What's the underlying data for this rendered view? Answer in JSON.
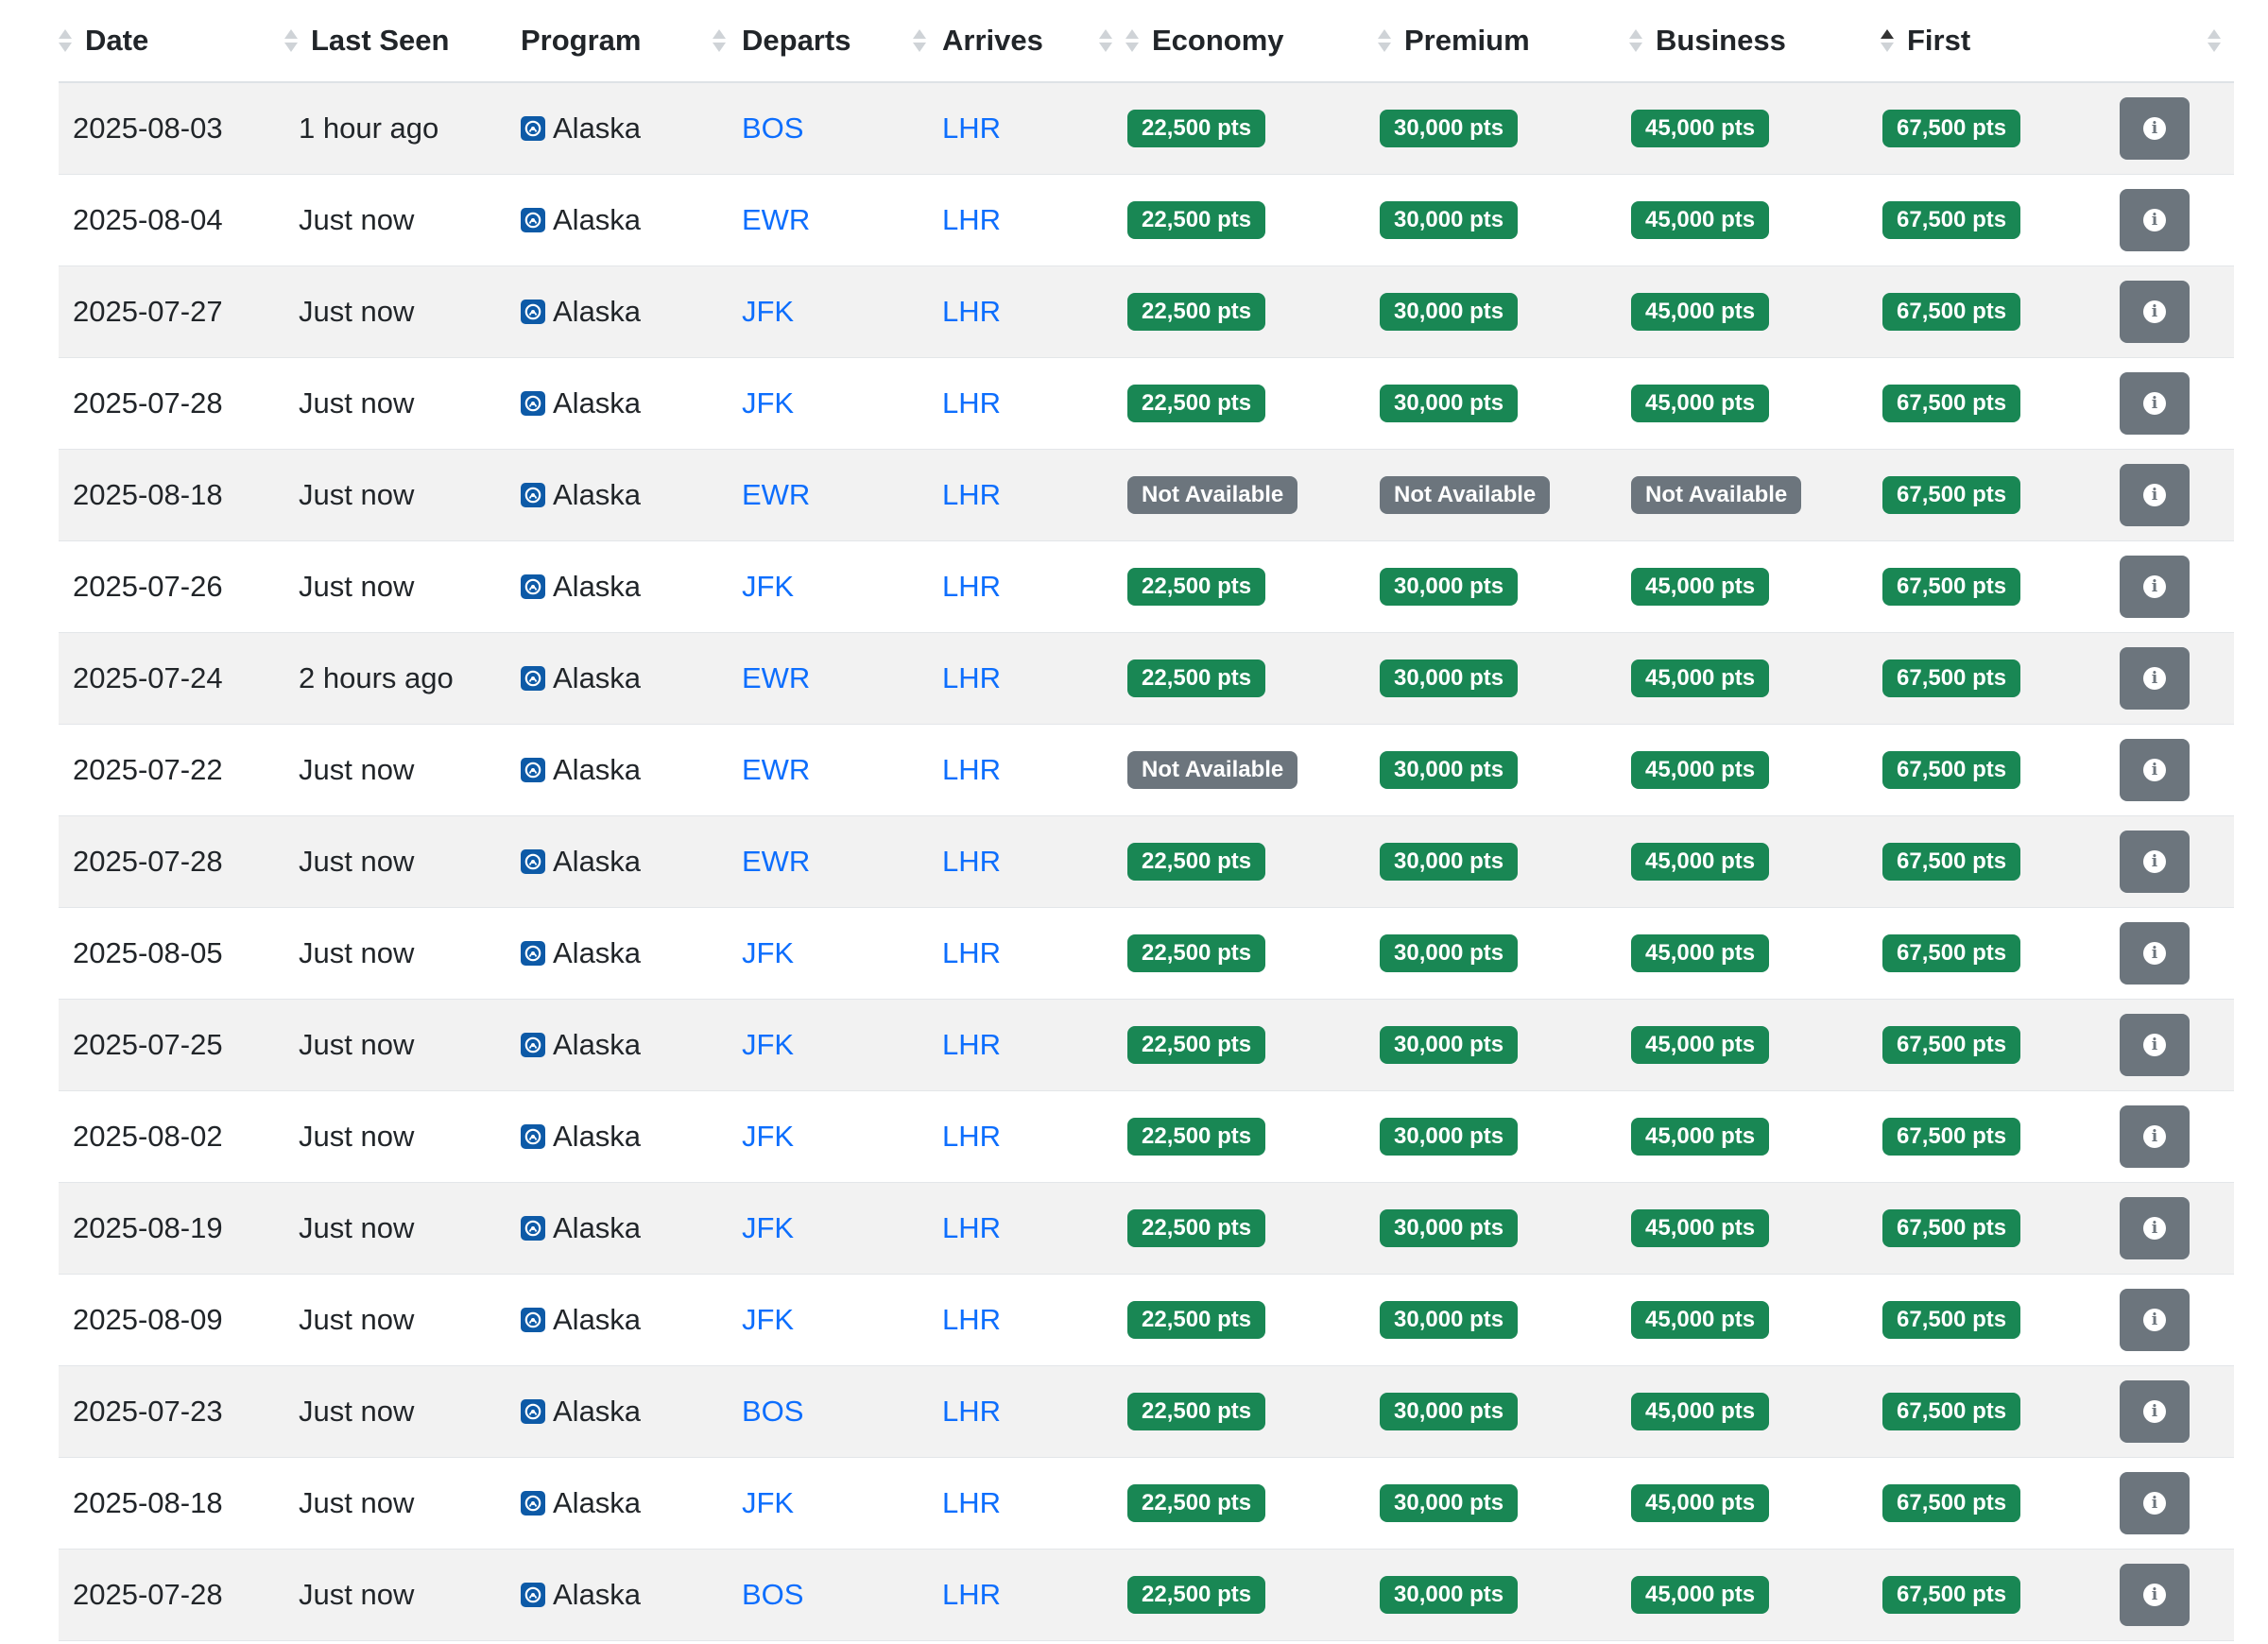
{
  "headers": {
    "date": "Date",
    "last_seen": "Last Seen",
    "program": "Program",
    "departs": "Departs",
    "arrives": "Arrives",
    "economy": "Economy",
    "premium": "Premium",
    "business": "Business",
    "first": "First"
  },
  "sort": {
    "column": "first",
    "direction": "ascending"
  },
  "colors": {
    "available_badge": "#198754",
    "unavailable_badge": "#6c757d",
    "link": "#0d6efd",
    "row_stripe": "#f2f2f2",
    "program_logo": "#0d5aa7"
  },
  "icons": {
    "program": "alaska-logo-icon",
    "details": "info-icon"
  },
  "rows": [
    {
      "date": "2025-08-03",
      "last_seen": "1 hour ago",
      "program": "Alaska",
      "departs": "BOS",
      "arrives": "LHR",
      "economy": "22,500 pts",
      "premium": "30,000 pts",
      "business": "45,000 pts",
      "first": "67,500 pts"
    },
    {
      "date": "2025-08-04",
      "last_seen": "Just now",
      "program": "Alaska",
      "departs": "EWR",
      "arrives": "LHR",
      "economy": "22,500 pts",
      "premium": "30,000 pts",
      "business": "45,000 pts",
      "first": "67,500 pts"
    },
    {
      "date": "2025-07-27",
      "last_seen": "Just now",
      "program": "Alaska",
      "departs": "JFK",
      "arrives": "LHR",
      "economy": "22,500 pts",
      "premium": "30,000 pts",
      "business": "45,000 pts",
      "first": "67,500 pts"
    },
    {
      "date": "2025-07-28",
      "last_seen": "Just now",
      "program": "Alaska",
      "departs": "JFK",
      "arrives": "LHR",
      "economy": "22,500 pts",
      "premium": "30,000 pts",
      "business": "45,000 pts",
      "first": "67,500 pts"
    },
    {
      "date": "2025-08-18",
      "last_seen": "Just now",
      "program": "Alaska",
      "departs": "EWR",
      "arrives": "LHR",
      "economy": "Not Available",
      "premium": "Not Available",
      "business": "Not Available",
      "first": "67,500 pts"
    },
    {
      "date": "2025-07-26",
      "last_seen": "Just now",
      "program": "Alaska",
      "departs": "JFK",
      "arrives": "LHR",
      "economy": "22,500 pts",
      "premium": "30,000 pts",
      "business": "45,000 pts",
      "first": "67,500 pts"
    },
    {
      "date": "2025-07-24",
      "last_seen": "2 hours ago",
      "program": "Alaska",
      "departs": "EWR",
      "arrives": "LHR",
      "economy": "22,500 pts",
      "premium": "30,000 pts",
      "business": "45,000 pts",
      "first": "67,500 pts"
    },
    {
      "date": "2025-07-22",
      "last_seen": "Just now",
      "program": "Alaska",
      "departs": "EWR",
      "arrives": "LHR",
      "economy": "Not Available",
      "premium": "30,000 pts",
      "business": "45,000 pts",
      "first": "67,500 pts"
    },
    {
      "date": "2025-07-28",
      "last_seen": "Just now",
      "program": "Alaska",
      "departs": "EWR",
      "arrives": "LHR",
      "economy": "22,500 pts",
      "premium": "30,000 pts",
      "business": "45,000 pts",
      "first": "67,500 pts"
    },
    {
      "date": "2025-08-05",
      "last_seen": "Just now",
      "program": "Alaska",
      "departs": "JFK",
      "arrives": "LHR",
      "economy": "22,500 pts",
      "premium": "30,000 pts",
      "business": "45,000 pts",
      "first": "67,500 pts"
    },
    {
      "date": "2025-07-25",
      "last_seen": "Just now",
      "program": "Alaska",
      "departs": "JFK",
      "arrives": "LHR",
      "economy": "22,500 pts",
      "premium": "30,000 pts",
      "business": "45,000 pts",
      "first": "67,500 pts"
    },
    {
      "date": "2025-08-02",
      "last_seen": "Just now",
      "program": "Alaska",
      "departs": "JFK",
      "arrives": "LHR",
      "economy": "22,500 pts",
      "premium": "30,000 pts",
      "business": "45,000 pts",
      "first": "67,500 pts"
    },
    {
      "date": "2025-08-19",
      "last_seen": "Just now",
      "program": "Alaska",
      "departs": "JFK",
      "arrives": "LHR",
      "economy": "22,500 pts",
      "premium": "30,000 pts",
      "business": "45,000 pts",
      "first": "67,500 pts"
    },
    {
      "date": "2025-08-09",
      "last_seen": "Just now",
      "program": "Alaska",
      "departs": "JFK",
      "arrives": "LHR",
      "economy": "22,500 pts",
      "premium": "30,000 pts",
      "business": "45,000 pts",
      "first": "67,500 pts"
    },
    {
      "date": "2025-07-23",
      "last_seen": "Just now",
      "program": "Alaska",
      "departs": "BOS",
      "arrives": "LHR",
      "economy": "22,500 pts",
      "premium": "30,000 pts",
      "business": "45,000 pts",
      "first": "67,500 pts"
    },
    {
      "date": "2025-08-18",
      "last_seen": "Just now",
      "program": "Alaska",
      "departs": "JFK",
      "arrives": "LHR",
      "economy": "22,500 pts",
      "premium": "30,000 pts",
      "business": "45,000 pts",
      "first": "67,500 pts"
    },
    {
      "date": "2025-07-28",
      "last_seen": "Just now",
      "program": "Alaska",
      "departs": "BOS",
      "arrives": "LHR",
      "economy": "22,500 pts",
      "premium": "30,000 pts",
      "business": "45,000 pts",
      "first": "67,500 pts"
    }
  ]
}
